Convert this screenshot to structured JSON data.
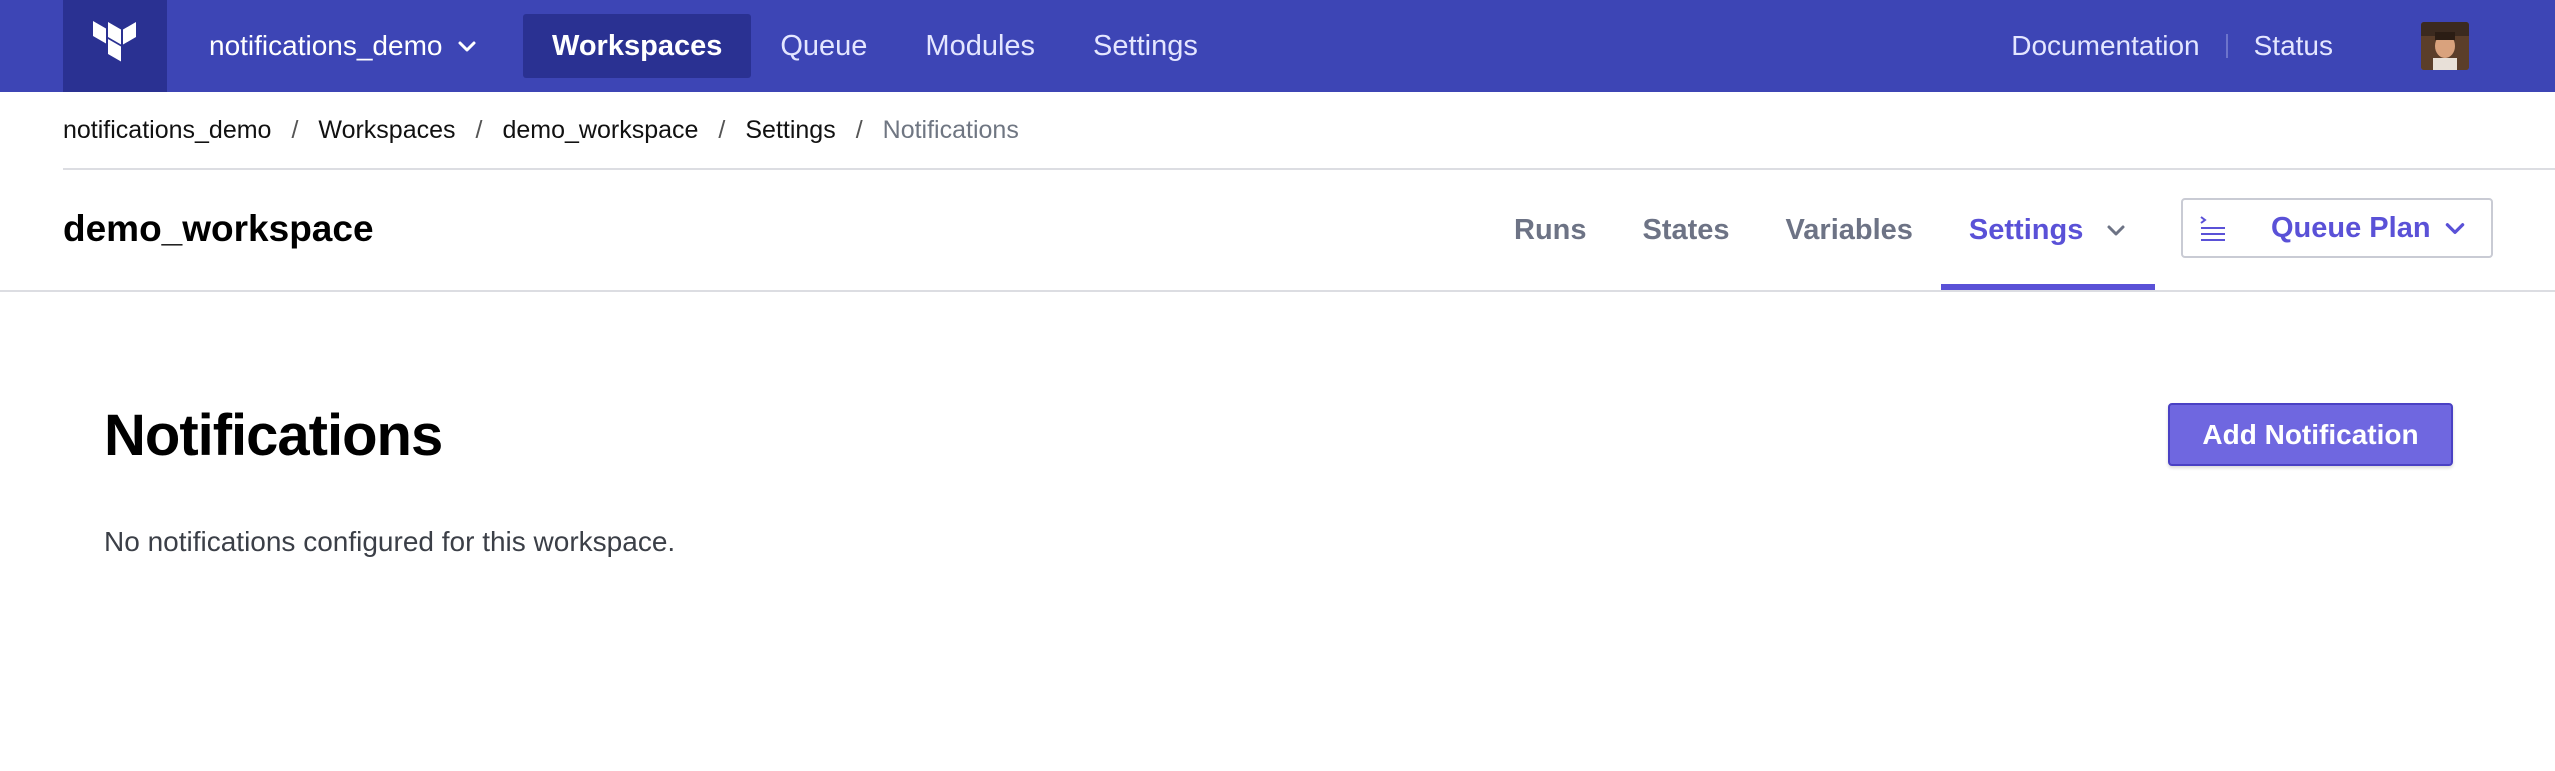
{
  "topnav": {
    "org_name": "notifications_demo",
    "links": [
      "Workspaces",
      "Queue",
      "Modules",
      "Settings"
    ],
    "right_links": [
      "Documentation",
      "Status"
    ]
  },
  "breadcrumb": [
    "notifications_demo",
    "Workspaces",
    "demo_workspace",
    "Settings",
    "Notifications"
  ],
  "workspace": {
    "title": "demo_workspace",
    "tabs": [
      "Runs",
      "States",
      "Variables",
      "Settings"
    ],
    "queue_label": "Queue Plan"
  },
  "content": {
    "title": "Notifications",
    "add_button": "Add Notification",
    "empty_message": "No notifications configured for this workspace."
  },
  "colors": {
    "nav_bg": "#3d45b5",
    "nav_active": "#2a3192",
    "accent": "#5a51d7",
    "button": "#6f67e0"
  },
  "icons": {
    "logo": "terraform-logo-icon",
    "org_menu": "chevron-down-icon",
    "queue": "queue-list-icon"
  }
}
